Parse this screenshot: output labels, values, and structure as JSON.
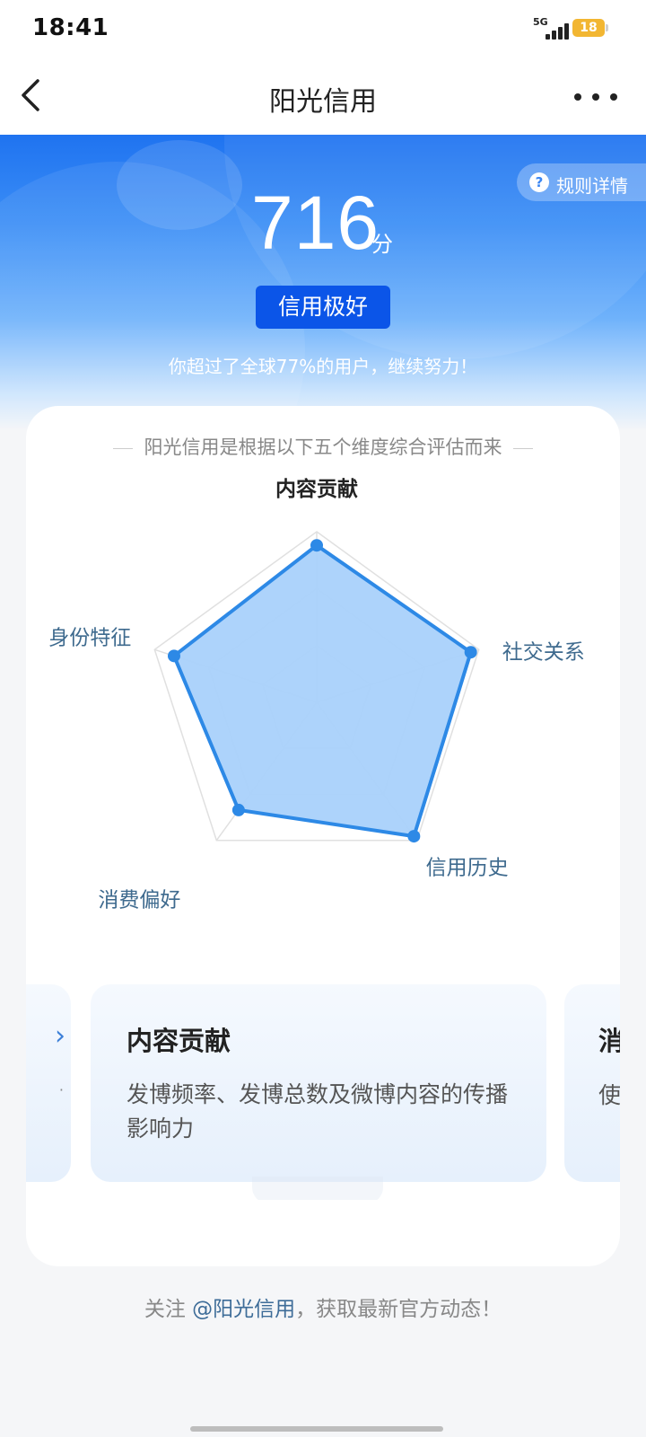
{
  "status_bar": {
    "time": "18:41",
    "network": "5G",
    "battery": "18"
  },
  "nav": {
    "title": "阳光信用",
    "back_icon": "chevron-left-icon",
    "more_icon": "more-dots-icon"
  },
  "hero": {
    "rules_label": "规则详情",
    "rules_icon": "question-circle-icon",
    "score": "716",
    "score_unit": "分",
    "level": "信用极好",
    "rank_text": "你超过了全球77%的用户，继续努力！"
  },
  "card": {
    "subtitle": "阳光信用是根据以下五个维度综合评估而来",
    "radar": {
      "dimensions": [
        {
          "label": "内容贡献",
          "value": 0.92
        },
        {
          "label": "社交关系",
          "value": 0.95
        },
        {
          "label": "信用历史",
          "value": 0.97
        },
        {
          "label": "消费偏好",
          "value": 0.78
        },
        {
          "label": "身份特征",
          "value": 0.88
        }
      ],
      "active_index": 0,
      "colors": {
        "fill": "#a9d1fb",
        "stroke": "#2d89e6",
        "grid": "#e0e0e0"
      }
    },
    "carousel": {
      "prev_arrow": "›",
      "prev_dot": "·",
      "current": {
        "title": "内容贡献",
        "description": "发博频率、发博总数及微博内容的传播影响力"
      },
      "next": {
        "title": "消",
        "description": "使"
      }
    }
  },
  "footer": {
    "prefix": "关注 ",
    "link": "@阳光信用",
    "suffix": "，获取最新官方动态！"
  }
}
